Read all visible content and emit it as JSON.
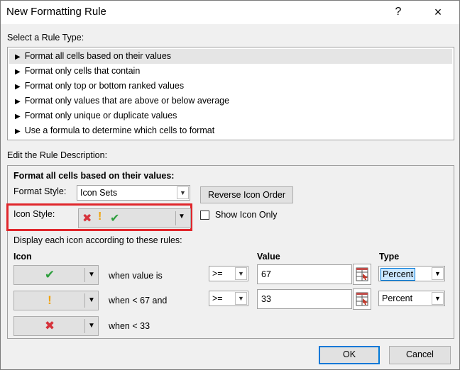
{
  "window": {
    "title": "New Formatting Rule",
    "help_icon": "?",
    "close_icon": "×"
  },
  "rule_type": {
    "label": "Select a Rule Type:",
    "items": [
      "Format all cells based on their values",
      "Format only cells that contain",
      "Format only top or bottom ranked values",
      "Format only values that are above or below average",
      "Format only unique or duplicate values",
      "Use a formula to determine which cells to format"
    ],
    "selected_index": 0,
    "arrow": "▶"
  },
  "description": {
    "label": "Edit the Rule Description:",
    "heading": "Format all cells based on their values:",
    "format_style_label": "Format Style:",
    "format_style_value": "Icon Sets",
    "reverse_button": "Reverse Icon Order",
    "icon_style_label": "Icon Style:",
    "icon_style_icons": [
      "red-x",
      "yellow-exclamation",
      "green-check"
    ],
    "show_icon_only_label": "Show Icon Only",
    "show_icon_only_checked": false,
    "display_rules_label": "Display each icon according to these rules:",
    "col_icon": "Icon",
    "col_value": "Value",
    "col_type": "Type",
    "rules": [
      {
        "icon": "green-check",
        "glyph": "✔",
        "text": "when value is",
        "operator": ">=",
        "value": "67",
        "type": "Percent",
        "type_selected": true
      },
      {
        "icon": "yellow-exclamation",
        "glyph": "!",
        "text": "when < 67 and",
        "operator": ">=",
        "value": "33",
        "type": "Percent",
        "type_selected": false
      },
      {
        "icon": "red-x",
        "glyph": "✖",
        "text": "when < 33"
      }
    ]
  },
  "buttons": {
    "ok": "OK",
    "cancel": "Cancel"
  },
  "colors": {
    "highlight": "#e0262b",
    "focus": "#0078d7",
    "green": "#2e9f3e",
    "red": "#d6323b",
    "yellow": "#f0a30a"
  }
}
